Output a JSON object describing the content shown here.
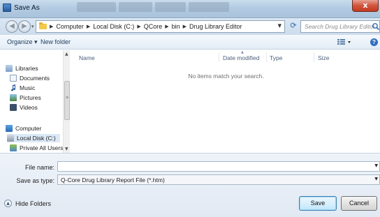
{
  "window": {
    "title": "Save As",
    "close_label": "x"
  },
  "address": {
    "crumbs": [
      "Computer",
      "Local Disk (C:)",
      "QCore",
      "bin",
      "Drug Library Editor"
    ],
    "search_placeholder": "Search Drug Library Editor"
  },
  "toolbar": {
    "organize": "Organize ▾",
    "new_folder": "New folder"
  },
  "nav": {
    "items": [
      {
        "label": "Libraries",
        "icon": "libraries-icon"
      },
      {
        "label": "Documents",
        "icon": "documents-icon"
      },
      {
        "label": "Music",
        "icon": "music-icon"
      },
      {
        "label": "Pictures",
        "icon": "pictures-icon"
      },
      {
        "label": "Videos",
        "icon": "videos-icon"
      },
      {
        "label": "Computer",
        "icon": "computer-icon"
      },
      {
        "label": "Local Disk (C:)",
        "icon": "disk-icon"
      },
      {
        "label": "Private All Users (",
        "icon": "network-drive-icon"
      }
    ]
  },
  "filelist": {
    "columns": [
      "Name",
      "Date modified",
      "Type",
      "Size"
    ],
    "empty_message": "No items match your search."
  },
  "form": {
    "filename_label": "File name:",
    "filename_value": "",
    "type_label": "Save as type:",
    "type_value": "Q-Core Drug Library Report File (*.htm)",
    "hide_folders": "Hide Folders",
    "save": "Save",
    "cancel": "Cancel"
  }
}
